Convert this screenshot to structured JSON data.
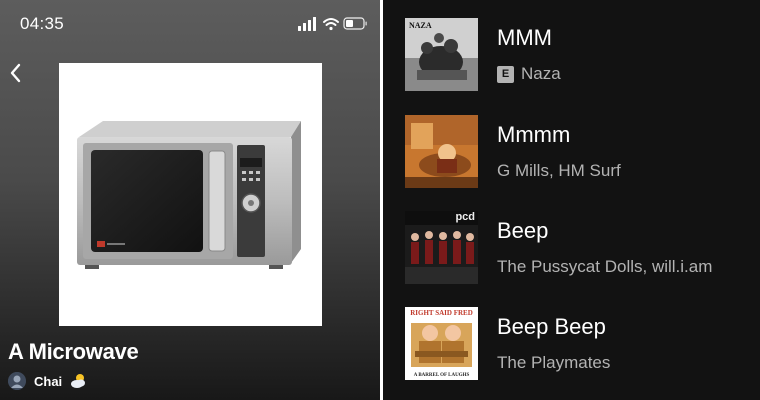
{
  "status": {
    "time": "04:35"
  },
  "playlist": {
    "title": "A Microwave",
    "owner": "Chai",
    "owner_emoji": "🌥"
  },
  "tracks": [
    {
      "title": "MMM",
      "artist": "Naza",
      "explicit": true,
      "explicit_label": "E",
      "art_text": "NAZA"
    },
    {
      "title": "Mmmm",
      "artist": "G Mills, HM Surf",
      "explicit": false
    },
    {
      "title": "Beep",
      "artist": "The Pussycat Dolls, will.i.am",
      "explicit": false,
      "art_text": "pcd"
    },
    {
      "title": "Beep Beep",
      "artist": "The Playmates",
      "explicit": false,
      "art_text": "RIGHT SAID FRED",
      "art_subtext": "A BARREL OF LAUGHS"
    }
  ],
  "colors": {
    "background": "#121212",
    "secondary_text": "#b3b3b3",
    "header_gradient_top": "#5d5d5d"
  }
}
